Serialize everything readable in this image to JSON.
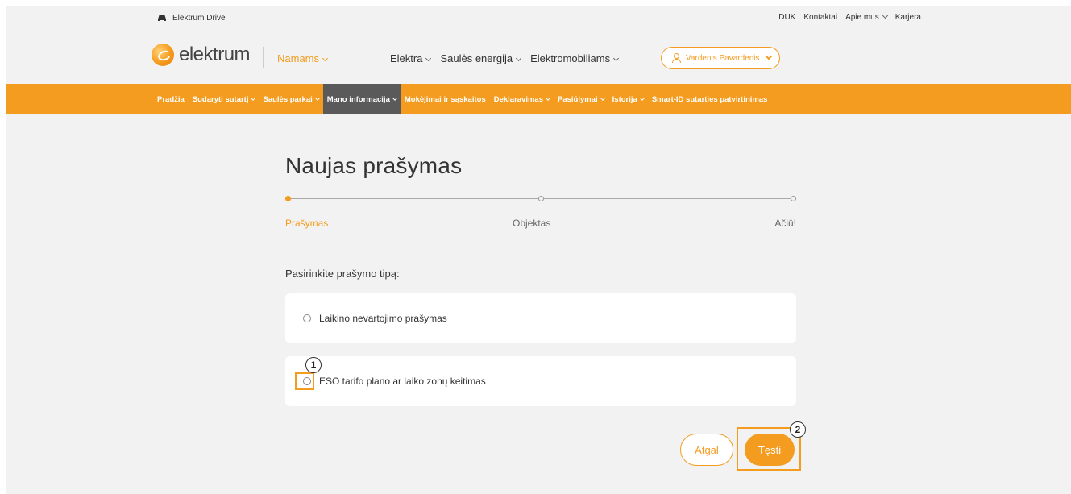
{
  "topbar": {
    "drive_label": "Elektrum Drive",
    "links": [
      "DUK",
      "Kontaktai",
      "Apie mus",
      "Karjera"
    ]
  },
  "header": {
    "logo_text": "elektrum",
    "segment": "Namams",
    "nav": [
      "Elektra",
      "Saulės energija",
      "Elektromobiliams"
    ],
    "user_name": "Vardenis Pavardenis"
  },
  "subnav": {
    "items": [
      {
        "label": "Pradžia",
        "dropdown": false
      },
      {
        "label": "Sudaryti sutartį",
        "dropdown": true
      },
      {
        "label": "Saulės parkai",
        "dropdown": true
      },
      {
        "label": "Mano informacija",
        "dropdown": true,
        "active": true
      },
      {
        "label": "Mokėjimai ir sąskaitos",
        "dropdown": false
      },
      {
        "label": "Deklaravimas",
        "dropdown": true
      },
      {
        "label": "Pasiūlymai",
        "dropdown": true
      },
      {
        "label": "Istorija",
        "dropdown": true
      },
      {
        "label": "Smart-ID sutarties patvirtinimas",
        "dropdown": false
      }
    ]
  },
  "main": {
    "title": "Naujas prašymas",
    "steps": [
      "Prašymas",
      "Objektas",
      "Ačiū!"
    ],
    "active_step": 0,
    "question": "Pasirinkite prašymo tipą:",
    "options": [
      "Laikino nevartojimo prašymas",
      "ESO tarifo plano ar laiko zonų keitimas"
    ],
    "back_label": "Atgal",
    "next_label": "Tęsti"
  },
  "annotations": [
    "1",
    "2"
  ],
  "colors": {
    "accent": "#f39c1f",
    "active_nav": "#5a5a5a",
    "background": "#f2f2f2"
  }
}
